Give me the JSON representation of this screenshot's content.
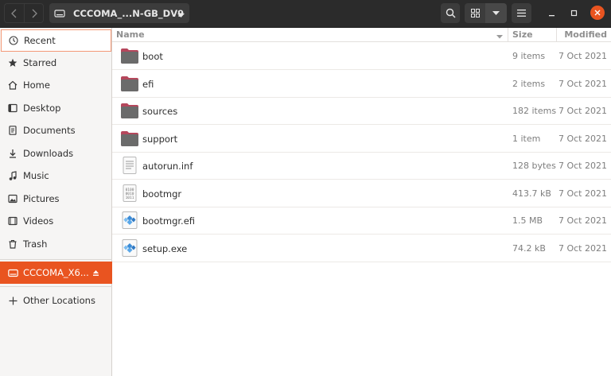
{
  "header": {
    "path_label": "CCCOMA_...N-GB_DV9"
  },
  "sidebar": {
    "items": [
      {
        "label": "Recent",
        "icon": "clock-icon"
      },
      {
        "label": "Starred",
        "icon": "star-icon"
      },
      {
        "label": "Home",
        "icon": "home-icon"
      },
      {
        "label": "Desktop",
        "icon": "desktop-icon"
      },
      {
        "label": "Documents",
        "icon": "documents-icon"
      },
      {
        "label": "Downloads",
        "icon": "download-icon"
      },
      {
        "label": "Music",
        "icon": "music-icon"
      },
      {
        "label": "Pictures",
        "icon": "pictures-icon"
      },
      {
        "label": "Videos",
        "icon": "videos-icon"
      },
      {
        "label": "Trash",
        "icon": "trash-icon"
      }
    ],
    "drive_label": "CCCOMA_X6...",
    "other_locations": "Other Locations"
  },
  "columns": {
    "name": "Name",
    "size": "Size",
    "modified": "Modified"
  },
  "files": [
    {
      "name": "boot",
      "size": "9 items",
      "modified": "7 Oct 2021",
      "type": "folder"
    },
    {
      "name": "efi",
      "size": "2 items",
      "modified": "7 Oct 2021",
      "type": "folder"
    },
    {
      "name": "sources",
      "size": "182 items",
      "modified": "7 Oct 2021",
      "type": "folder"
    },
    {
      "name": "support",
      "size": "1 item",
      "modified": "7 Oct 2021",
      "type": "folder"
    },
    {
      "name": "autorun.inf",
      "size": "128 bytes",
      "modified": "7 Oct 2021",
      "type": "text"
    },
    {
      "name": "bootmgr",
      "size": "413.7 kB",
      "modified": "7 Oct 2021",
      "type": "binary"
    },
    {
      "name": "bootmgr.efi",
      "size": "1.5 MB",
      "modified": "7 Oct 2021",
      "type": "executable"
    },
    {
      "name": "setup.exe",
      "size": "74.2 kB",
      "modified": "7 Oct 2021",
      "type": "executable"
    }
  ],
  "colors": {
    "accent": "#e95420",
    "headerbar": "#2b2b2b",
    "folder": "#6b6b6b",
    "folder_tab": "#b5475c"
  }
}
